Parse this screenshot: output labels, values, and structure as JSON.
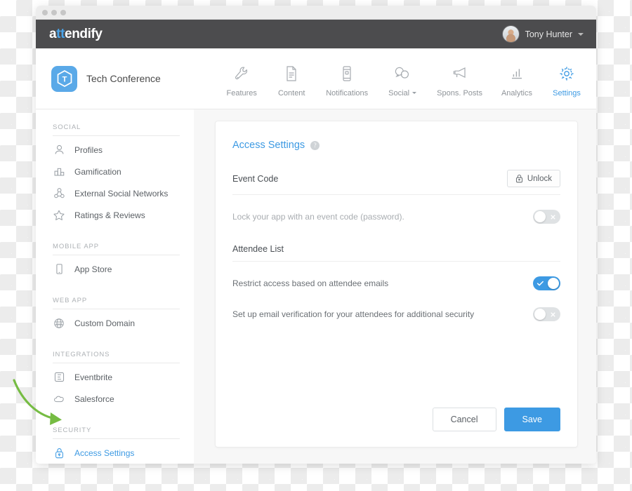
{
  "window": {
    "traffic_lights": 3
  },
  "brandbar": {
    "logo_prefix": "a",
    "logo_highlight": "tt",
    "logo_suffix": "endify",
    "user_name": "Tony Hunter",
    "avatar_icon": "user-avatar",
    "caret_icon": "chevron-down-icon"
  },
  "navbar": {
    "event_icon": "app-hexagon-icon",
    "event_letter": "T",
    "event_title": "Tech Conference",
    "items": [
      {
        "label": "Features",
        "icon": "wrench-icon",
        "active": false,
        "has_caret": false
      },
      {
        "label": "Content",
        "icon": "document-icon",
        "active": false,
        "has_caret": false
      },
      {
        "label": "Notifications",
        "icon": "mobile-phone-icon",
        "active": false,
        "has_caret": false
      },
      {
        "label": "Social",
        "icon": "chat-bubbles-icon",
        "active": false,
        "has_caret": true
      },
      {
        "label": "Spons. Posts",
        "icon": "megaphone-icon",
        "active": false,
        "has_caret": false
      },
      {
        "label": "Analytics",
        "icon": "bar-chart-icon",
        "active": false,
        "has_caret": false
      },
      {
        "label": "Settings",
        "icon": "gear-icon",
        "active": true,
        "has_caret": false
      }
    ]
  },
  "sidebar": {
    "groups": [
      {
        "heading": "SOCIAL",
        "items": [
          {
            "label": "Profiles",
            "icon": "person-icon",
            "active": false
          },
          {
            "label": "Gamification",
            "icon": "podium-icon",
            "active": false
          },
          {
            "label": "External Social Networks",
            "icon": "network-nodes-icon",
            "active": false
          },
          {
            "label": "Ratings & Reviews",
            "icon": "star-icon",
            "active": false
          }
        ]
      },
      {
        "heading": "MOBILE APP",
        "items": [
          {
            "label": "App Store",
            "icon": "mobile-phone-icon",
            "active": false
          }
        ]
      },
      {
        "heading": "WEB APP",
        "items": [
          {
            "label": "Custom Domain",
            "icon": "globe-www-icon",
            "active": false
          }
        ]
      },
      {
        "heading": "INTEGRATIONS",
        "items": [
          {
            "label": "Eventbrite",
            "icon": "eventbrite-icon",
            "active": false
          },
          {
            "label": "Salesforce",
            "icon": "cloud-icon",
            "active": false
          }
        ]
      },
      {
        "heading": "SECURITY",
        "items": [
          {
            "label": "Access Settings",
            "icon": "padlock-icon",
            "active": true
          }
        ]
      }
    ]
  },
  "main": {
    "card_title": "Access Settings",
    "help_icon": "question-mark-icon",
    "help_glyph": "?",
    "sections": [
      {
        "title": "Event Code",
        "action_button": {
          "label": "Unlock",
          "icon": "padlock-icon"
        },
        "rows": [
          {
            "label": "Lock your app with an event code (password).",
            "muted": true,
            "toggle_state": "off"
          }
        ]
      },
      {
        "title": "Attendee List",
        "action_button": null,
        "rows": [
          {
            "label": "Restrict access based on attendee emails",
            "muted": false,
            "toggle_state": "on"
          },
          {
            "label": "Set up email verification for your attendees for additional security",
            "muted": false,
            "toggle_state": "off"
          }
        ]
      }
    ],
    "footer": {
      "cancel_label": "Cancel",
      "save_label": "Save"
    }
  },
  "annotation": {
    "arrow_icon": "green-curved-arrow",
    "color": "#76bc43",
    "points_to": "sidebar-item-access-settings"
  },
  "colors": {
    "accent_blue": "#3d9ae3",
    "brand_dark": "#4c4c4e",
    "annotation_green": "#76bc43",
    "toggle_off": "#dfe2e4"
  }
}
